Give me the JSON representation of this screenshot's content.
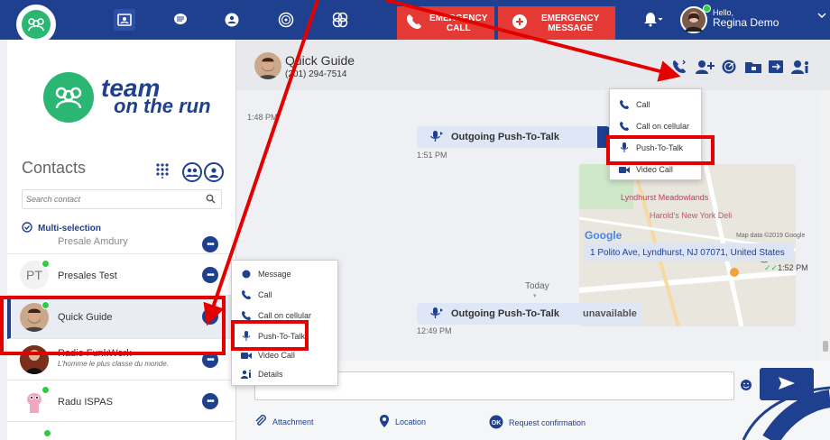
{
  "topbar": {
    "emergency_call": [
      "EMERGENCY",
      "CALL"
    ],
    "emergency_message": [
      "EMERGENCY",
      "MESSAGE"
    ],
    "user_greeting": "Hello,",
    "user_name": "Regina Demo"
  },
  "sidebar": {
    "brand_line1": "team",
    "brand_line2": "on the run",
    "contacts_title": "Contacts",
    "search_placeholder": "Search contact",
    "multi_selection": "Multi-selection",
    "contacts": [
      {
        "name": "Presale Amdury",
        "subtitle": "",
        "initials": ""
      },
      {
        "name": "Presales Test",
        "subtitle": "",
        "initials": "PT"
      },
      {
        "name": "Quick Guide",
        "subtitle": "",
        "initials": ""
      },
      {
        "name": "Radio FunkWerk",
        "subtitle": "L'homme le plus classe du monde.",
        "initials": ""
      },
      {
        "name": "Radu ISPAS",
        "subtitle": "",
        "initials": ""
      }
    ]
  },
  "chat": {
    "contact_name": "Quick Guide",
    "contact_phone": "(201) 294-7514",
    "messages": [
      {
        "time": "1:48 PM"
      },
      {
        "label": "Outgoing Push-To-Talk",
        "time": "1:51 PM"
      },
      {
        "map_address": "1 Polito Ave, Lyndhurst, NJ 07071, United States",
        "map_credit": "Map data ©2019 Google",
        "map_brand": "Google",
        "map_place1": "Lyndhurst Meadowlands",
        "map_place2": "Harold's New York Deli",
        "time": "1:52 PM"
      },
      {
        "divider": "Today"
      },
      {
        "label": "Outgoing Push-To-Talk",
        "status": "unavailable",
        "time": "12:49 PM"
      }
    ]
  },
  "composer": {
    "attachment": "Attachment",
    "location": "Location",
    "request_confirmation": "Request confirmation"
  },
  "call_menu": {
    "items": [
      "Call",
      "Call on cellular",
      "Push-To-Talk",
      "Video Call"
    ]
  },
  "context_menu": {
    "items": [
      "Message",
      "Call",
      "Call on cellular",
      "Push-To-Talk",
      "Video Call",
      "Details"
    ]
  },
  "colors": {
    "brand_blue": "#1f3f8f",
    "brand_green": "#2bb673",
    "emergency_red": "#e53935",
    "annotation_red": "#e50000"
  }
}
